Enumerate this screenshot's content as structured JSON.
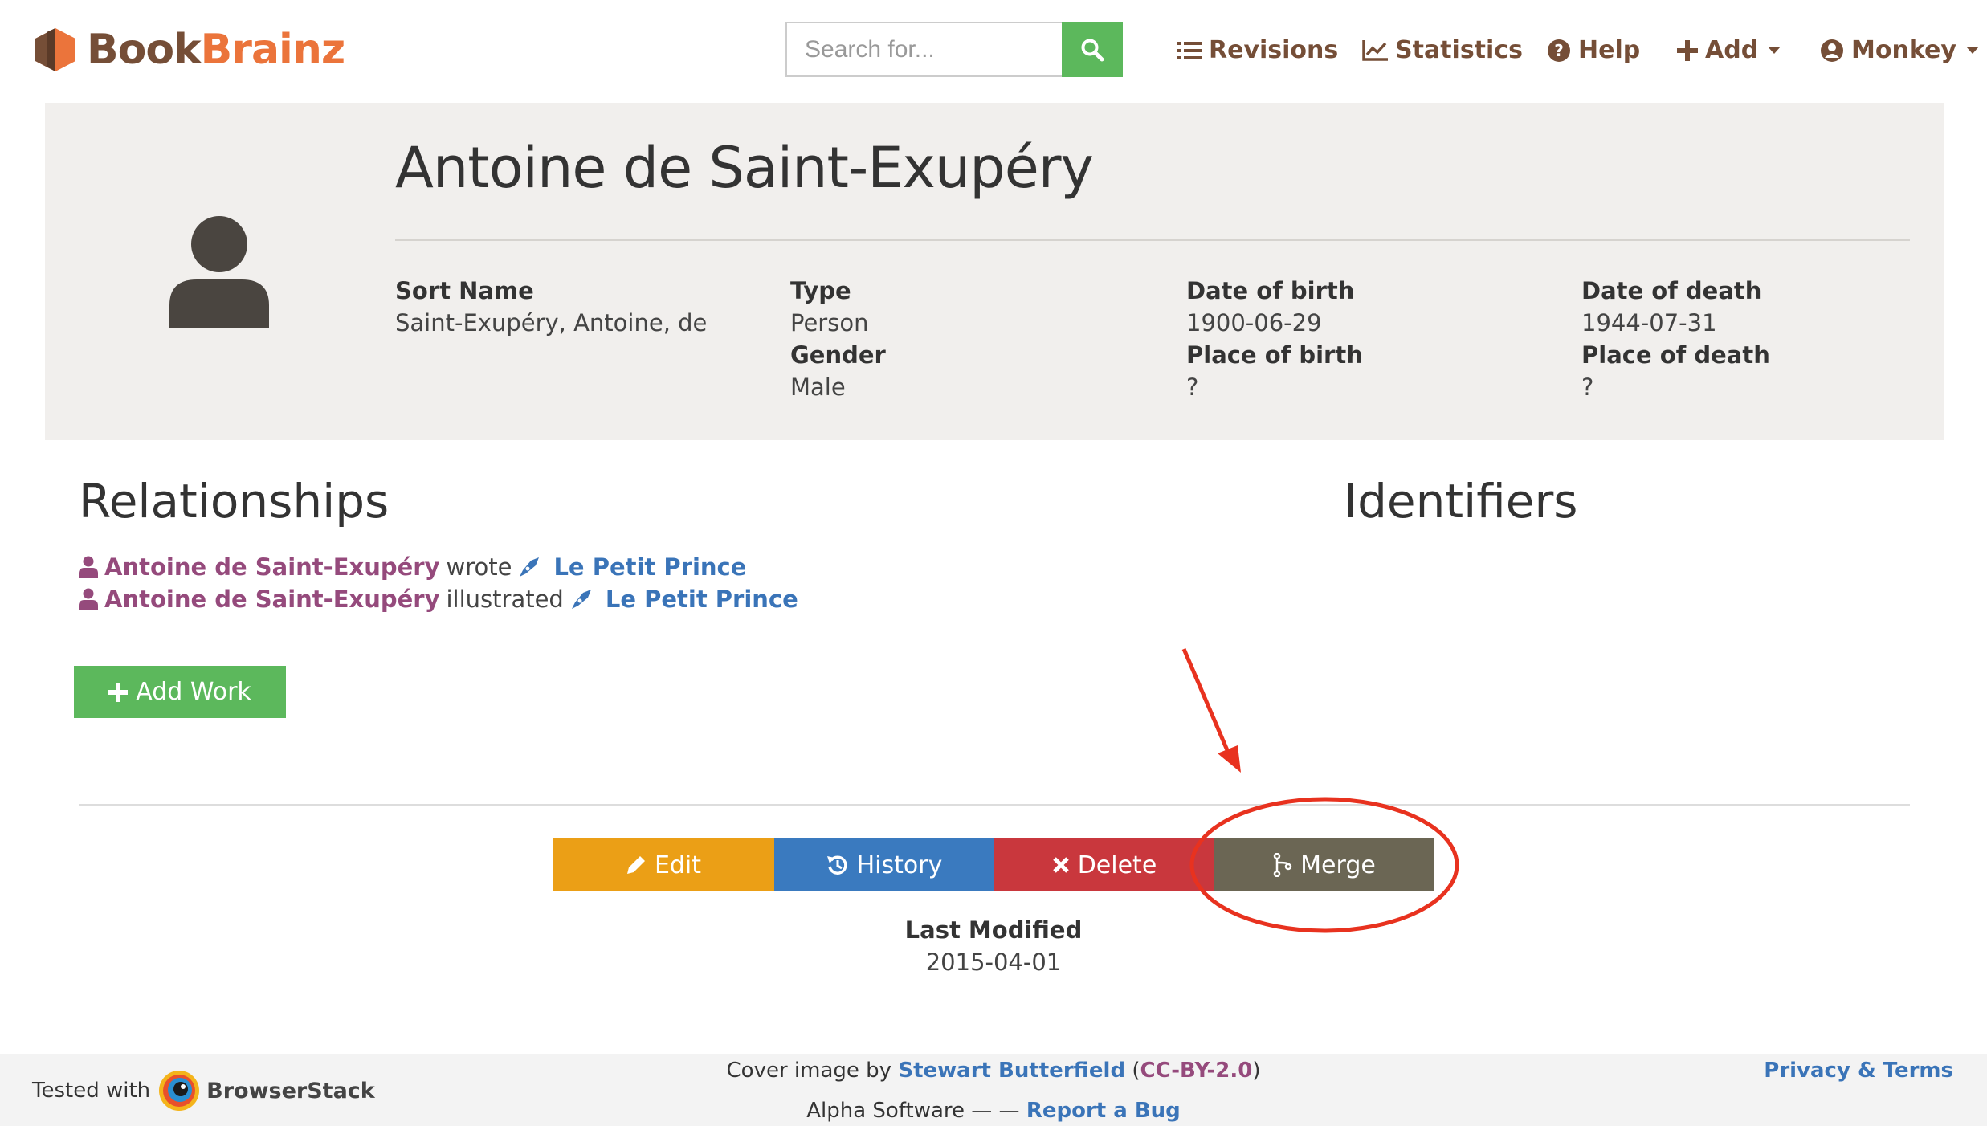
{
  "brand": {
    "part1": "Book",
    "part2": "Brainz"
  },
  "search": {
    "placeholder": "Search for..."
  },
  "nav": {
    "revisions": "Revisions",
    "statistics": "Statistics",
    "help": "Help",
    "add": "Add",
    "user": "Monkey"
  },
  "entity": {
    "name": "Antoine de Saint-Exupéry",
    "attributes": {
      "sort_name_label": "Sort Name",
      "sort_name": "Saint-Exupéry, Antoine, de",
      "type_label": "Type",
      "type": "Person",
      "gender_label": "Gender",
      "gender": "Male",
      "dob_label": "Date of birth",
      "dob": "1900-06-29",
      "pob_label": "Place of birth",
      "pob": "?",
      "dod_label": "Date of death",
      "dod": "1944-07-31",
      "pod_label": "Place of death",
      "pod": "?"
    }
  },
  "relationships": {
    "title": "Relationships",
    "items": [
      {
        "author": "Antoine de Saint-Exupéry",
        "verb": "wrote",
        "work": "Le Petit Prince"
      },
      {
        "author": "Antoine de Saint-Exupéry",
        "verb": "illustrated",
        "work": "Le Petit Prince"
      }
    ]
  },
  "identifiers": {
    "title": "Identifiers"
  },
  "actions": {
    "add_work": "Add Work",
    "edit": "Edit",
    "history": "History",
    "delete": "Delete",
    "merge": "Merge"
  },
  "last_modified": {
    "label": "Last Modified",
    "value": "2015-04-01"
  },
  "footer": {
    "tested_with": "Tested with",
    "browserstack": "BrowserStack",
    "cover_prefix": "Cover image by",
    "cover_author": "Stewart Butterfield",
    "cover_license": "CC-BY-2.0",
    "alpha": "Alpha Software — —",
    "report_bug": "Report a Bug",
    "privacy": "Privacy & Terms"
  },
  "colors": {
    "brand_brown": "#754e37",
    "brand_orange": "#eb743b",
    "success": "#5cb85c",
    "edit": "#eb9f16",
    "history": "#3a7abf",
    "delete": "#c9373d",
    "merge": "#6b6654",
    "annotation": "#e8321f"
  }
}
